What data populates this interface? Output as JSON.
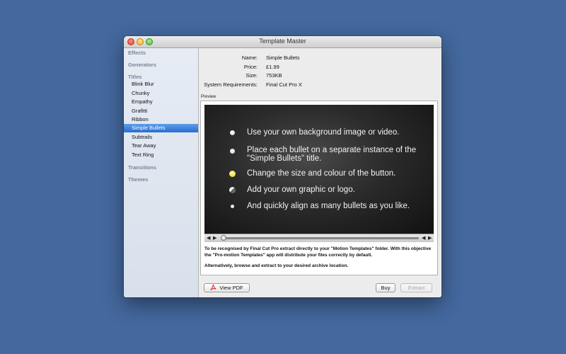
{
  "window": {
    "title": "Template Master"
  },
  "sidebar": {
    "sections": [
      {
        "label": "Effects"
      },
      {
        "label": "Generators"
      },
      {
        "label": "Titles"
      },
      {
        "label": "Transitions"
      },
      {
        "label": "Themes"
      }
    ],
    "items": [
      {
        "label": "Blink Blur"
      },
      {
        "label": "Chunky"
      },
      {
        "label": "Empathy"
      },
      {
        "label": "Grafitti"
      },
      {
        "label": "Ribbon"
      },
      {
        "label": "Simple Bullets",
        "selected": true
      },
      {
        "label": "Subtrails"
      },
      {
        "label": "Tear Away"
      },
      {
        "label": "Text Ring"
      }
    ]
  },
  "info": {
    "name_label": "Name:",
    "name_value": "Simple Bullets",
    "price_label": "Price:",
    "price_value": "£1.99",
    "size_label": "Size:",
    "size_value": "753KB",
    "req_label": "System Requirements:",
    "req_value": "Final Cut Pro X"
  },
  "preview": {
    "label": "Preview",
    "bullets": [
      {
        "text": "Use your own background image or video.",
        "style": "white"
      },
      {
        "text": "Place each bullet on a separate instance of the \"Simple Bullets\" title.",
        "style": "white"
      },
      {
        "text": "Change the size and colour of the button.",
        "style": "yellow"
      },
      {
        "text": "Add your own graphic or logo.",
        "style": "logo"
      },
      {
        "text": "And quickly align as many bullets as you like.",
        "style": "small"
      }
    ],
    "playback_fraction": 0.0
  },
  "description": {
    "p1": "To be recognised by Final Cut Pro extract directly to your \"Motion Templates\" folder. With this objective the \"Pro-motion Templates\" app will distribute your files correctly by default.",
    "p2": "Alternatively, browse and extract to your desired archive location."
  },
  "buttons": {
    "view_pdf": "View PDF",
    "buy": "Buy",
    "extract": "Extract"
  },
  "colors": {
    "desktop": "#44699f",
    "selection": "#2a6ccf",
    "bullet_yellow": "#e6d300"
  }
}
